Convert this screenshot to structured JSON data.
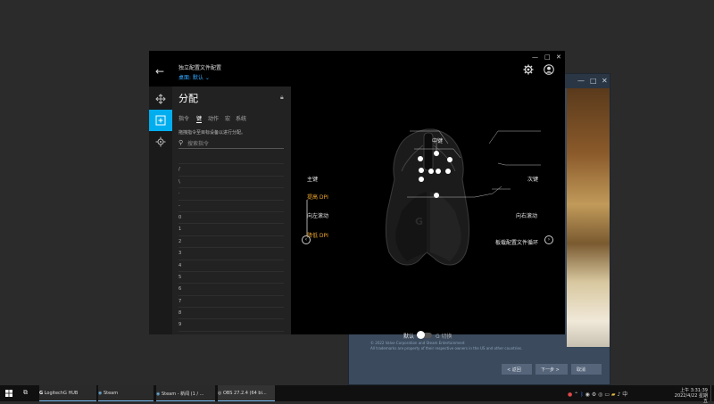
{
  "background_window": {
    "copyright_line1": "© 2022 Valve Corporation and Steam Entertainment",
    "copyright_line2": "All trademarks are property of their respective owners in the US and other countries.",
    "back_button": "< 返回",
    "next_button": "下一步 >",
    "cancel_button": "取消"
  },
  "main_window": {
    "profile_title": "独立配置文件配置",
    "profile_sub": "桌面: 默认",
    "panel": {
      "title": "分配",
      "tabs": [
        "指令",
        "键",
        "动作",
        "宏",
        "系统"
      ],
      "active_tab": 1,
      "hint": "拖拽指令至目标设备以进行分配。",
      "search_placeholder": "搜索指令",
      "keys": [
        "",
        "/",
        "\\",
        "·",
        "-",
        "0",
        "1",
        "2",
        "3",
        "4",
        "5",
        "6",
        "7",
        "8",
        "9"
      ]
    },
    "mouse_labels": {
      "middle": "中键",
      "primary": "主键",
      "secondary": "次键",
      "dpi_up": "提高 DPI",
      "scroll_left": "向左滚动",
      "scroll_right": "向右滚动",
      "dpi_down": "降低 DPI",
      "profile_cycle": "板载配置文件循环"
    },
    "toggle": {
      "left": "默认",
      "right": "G 切换"
    },
    "accent_color": "#00aeef",
    "dpi_label_color": "#f0a72c"
  },
  "taskbar": {
    "items": [
      "LogitechG HUB",
      "Steam",
      "Steam - 新闻 (1 / ...",
      "OBS 27.2.4 (64 bi..."
    ],
    "clock_time": "上午 3:31:39",
    "clock_date": "2022/4/22 星期五"
  }
}
